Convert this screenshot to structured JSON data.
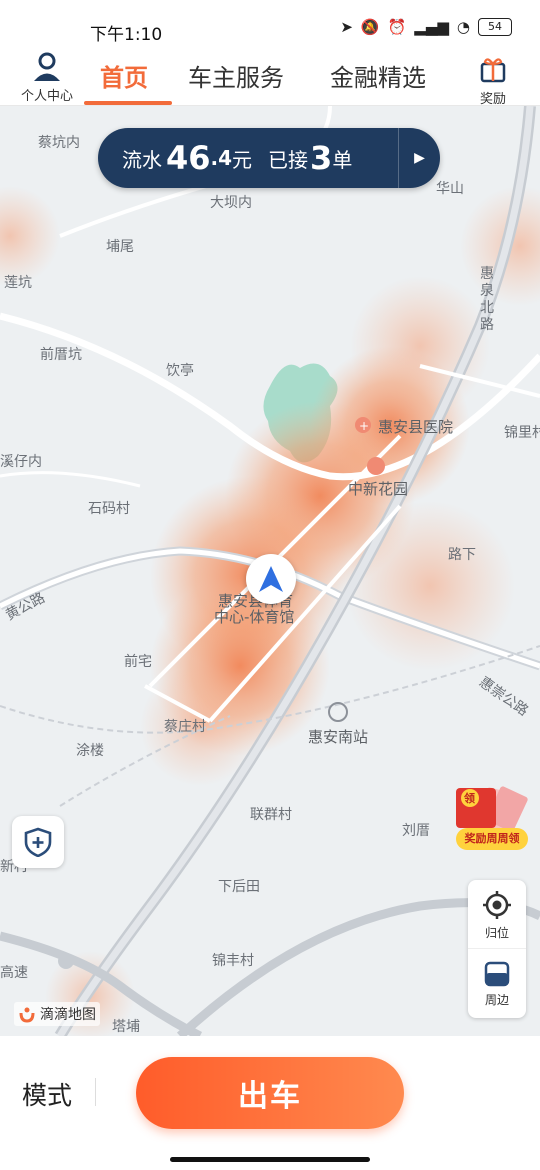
{
  "status_bar": {
    "time": "下午1:10",
    "battery": "54",
    "icons": [
      "location-icon",
      "mute-icon",
      "alarm-icon",
      "hd-signal-icon",
      "wifi-icon",
      "battery-icon"
    ]
  },
  "nav": {
    "profile_label": "个人中心",
    "tabs": [
      {
        "label": "首页",
        "active": true
      },
      {
        "label": "车主服务",
        "active": false
      },
      {
        "label": "金融精选",
        "active": false
      }
    ],
    "reward_label": "奖励",
    "accent_color": "#f26b3a"
  },
  "earnings": {
    "flow_label": "流水",
    "amount_int": "46",
    "amount_dec": ".4",
    "unit": "元",
    "orders_label": "已接",
    "orders_count": "3",
    "orders_unit": "单",
    "bg_color": "#1f3b5f"
  },
  "map": {
    "labels": {
      "caikeng": "蔡坑内",
      "dabakeng": "大坝内",
      "huashan": "华山",
      "puwei": "埔尾",
      "liankeng": "莲坑",
      "qiancuokeng": "前厝坑",
      "yinting": "饮亭",
      "huiquan_road": "惠泉北路",
      "hospital": "惠安县医院",
      "jinlicun": "锦里村",
      "xizaicun": "溪仔内",
      "zhongxin_garden": "中新花园",
      "shimacun": "石码村",
      "luxia": "路下",
      "huang_road": "黄公路",
      "gym_line1": "惠安县体育",
      "gym_line2": "中心-体育馆",
      "qianzhai": "前宅",
      "huichong_road": "惠崇公路",
      "caizhuangcun": "蔡庄村",
      "south_station": "惠安南站",
      "tulou": "涂楼",
      "lianqun": "联群村",
      "liucuo": "刘厝",
      "xinjia": "新村",
      "xiahoutian": "下后田",
      "jinfengcun": "锦丰村",
      "gaosu": "高速",
      "tapu": "塔埔"
    },
    "logo_text": "滴滴地图",
    "promo_text": "奖励周周领",
    "promo_badge": "领",
    "locate_label": "归位",
    "nearby_label": "周边"
  },
  "bottom": {
    "mode_label": "模式",
    "go_label": "出车",
    "go_color": "#ff5c2a"
  }
}
